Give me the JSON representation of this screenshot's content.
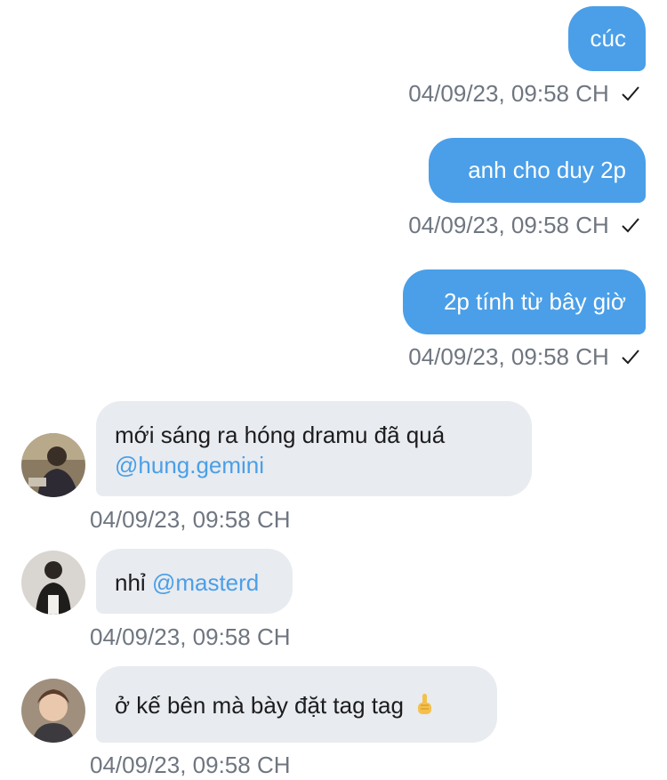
{
  "outgoing": [
    {
      "text": "cúc",
      "time": "04/09/23, 09:58 CH"
    },
    {
      "text": "anh cho duy 2p",
      "time": "04/09/23, 09:58 CH"
    },
    {
      "text": "2p tính từ bây giờ",
      "time": "04/09/23, 09:58 CH"
    }
  ],
  "incoming": [
    {
      "line1": "mới sáng ra hóng dramu đã quá",
      "mention": "@hung.gemini",
      "time": "04/09/23, 09:58 CH",
      "avatar_icon": "user-avatar"
    },
    {
      "prefix": "nhỉ",
      "mention": "@masterd",
      "time": "04/09/23, 09:58 CH",
      "avatar_icon": "user-avatar"
    },
    {
      "text": "ở kế bên mà bày đặt tag tag",
      "emoji": "pointing-up-hand",
      "time": "04/09/23, 09:58 CH",
      "avatar_icon": "user-avatar"
    }
  ],
  "colors": {
    "outgoing_bubble": "#4a9fe8",
    "incoming_bubble": "#e8ebef",
    "mention": "#4a9fe8",
    "timestamp": "#6f7680"
  },
  "status_icon": "check-icon"
}
